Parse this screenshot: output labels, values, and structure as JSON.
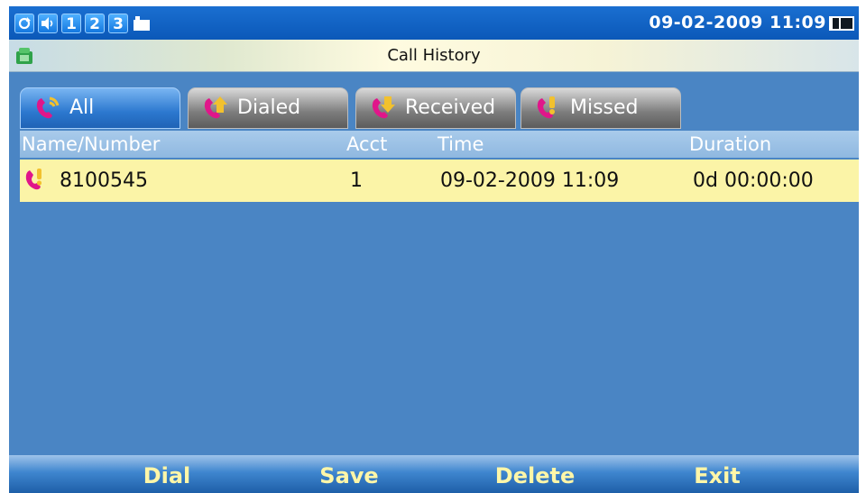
{
  "status_bar": {
    "line_indicators": [
      "1",
      "2",
      "3"
    ],
    "datetime": "09-02-2009 11:09",
    "icons": [
      "sync-icon",
      "speaker-icon",
      "line-1-indicator",
      "line-2-indicator",
      "line-3-indicator",
      "voicemail-icon",
      "battery-icon"
    ]
  },
  "title_bar": {
    "title": "Call History",
    "icon": "phone-book-icon"
  },
  "tabs": [
    {
      "label": "All",
      "icon": "all-calls-icon",
      "active": true
    },
    {
      "label": "Dialed",
      "icon": "dialed-calls-icon",
      "active": false
    },
    {
      "label": "Received",
      "icon": "received-calls-icon",
      "active": false
    },
    {
      "label": "Missed",
      "icon": "missed-calls-icon",
      "active": false
    }
  ],
  "table": {
    "columns": [
      "Name/Number",
      "Acct",
      "Time",
      "Duration"
    ],
    "rows": [
      {
        "type": "missed",
        "icon": "missed-call-icon",
        "number": "8100545",
        "acct": "1",
        "time": "09-02-2009 11:09",
        "duration": "0d 00:00:00"
      }
    ]
  },
  "softkeys": [
    "Dial",
    "Save",
    "Delete",
    "Exit"
  ],
  "colors": {
    "background": "#4a85c4",
    "status_bar": "#0b58b8",
    "selected_row": "#fbf4a7",
    "softkey_text": "#fff6a8",
    "handset": "#e0168a"
  }
}
